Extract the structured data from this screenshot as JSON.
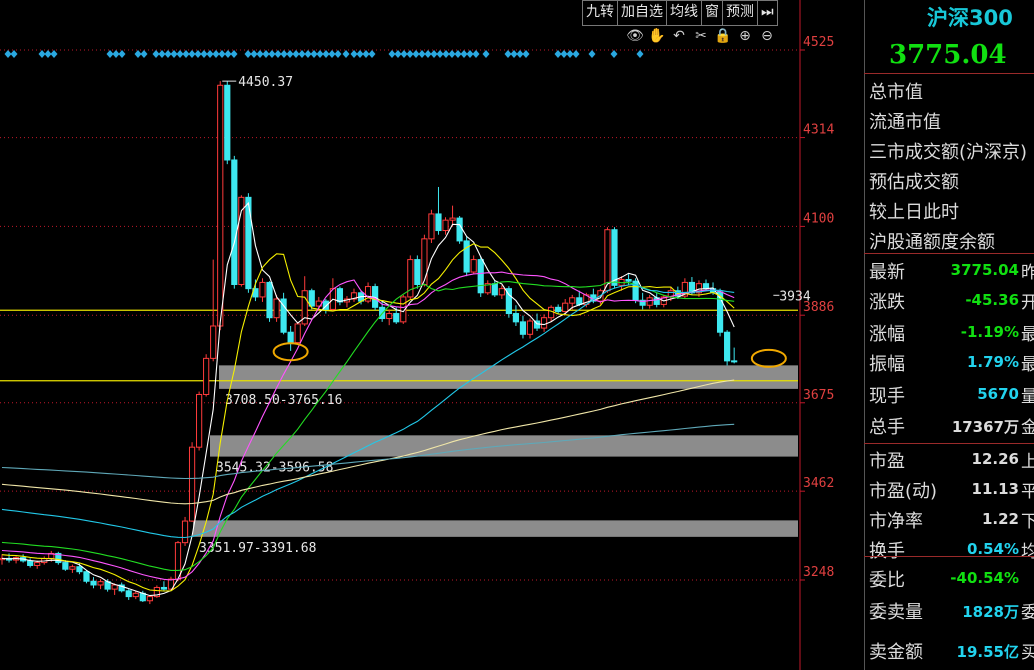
{
  "toolbar": {
    "items": [
      "九转",
      "加自选",
      "均线",
      "窗",
      "预测"
    ],
    "nav_icon": "play-to-end-icon"
  },
  "chart_icons": [
    "eye-icon",
    "hand-icon",
    "undo-icon",
    "scissors-icon",
    "lock-icon",
    "zoom-in-icon",
    "zoom-out-icon"
  ],
  "chart_data": {
    "type": "candlestick",
    "y_ticks": [
      "4525",
      "4314",
      "4100",
      "3886",
      "3675",
      "3462",
      "3248"
    ],
    "ylim": [
      3150,
      4560
    ],
    "annotations": {
      "high_label": "4450.37",
      "right_label": "3934"
    },
    "zones": [
      {
        "label": "3708.50-3765.16",
        "low": 3708.5,
        "high": 3765.16
      },
      {
        "label": "3545.32-3596.58",
        "low": 3545.32,
        "high": 3596.58
      },
      {
        "label": "3351.97-3391.68",
        "low": 3351.97,
        "high": 3391.68
      }
    ],
    "reference_lines": [
      3898,
      3728
    ],
    "candles": [
      {
        "o": 3297,
        "h": 3310,
        "l": 3285,
        "c": 3300
      },
      {
        "o": 3300,
        "h": 3312,
        "l": 3290,
        "c": 3296
      },
      {
        "o": 3296,
        "h": 3305,
        "l": 3288,
        "c": 3302
      },
      {
        "o": 3302,
        "h": 3310,
        "l": 3290,
        "c": 3294
      },
      {
        "o": 3294,
        "h": 3300,
        "l": 3278,
        "c": 3283
      },
      {
        "o": 3283,
        "h": 3295,
        "l": 3275,
        "c": 3290
      },
      {
        "o": 3290,
        "h": 3305,
        "l": 3285,
        "c": 3300
      },
      {
        "o": 3300,
        "h": 3318,
        "l": 3292,
        "c": 3312
      },
      {
        "o": 3312,
        "h": 3316,
        "l": 3285,
        "c": 3290
      },
      {
        "o": 3290,
        "h": 3296,
        "l": 3270,
        "c": 3274
      },
      {
        "o": 3274,
        "h": 3285,
        "l": 3265,
        "c": 3280
      },
      {
        "o": 3280,
        "h": 3290,
        "l": 3262,
        "c": 3268
      },
      {
        "o": 3268,
        "h": 3272,
        "l": 3240,
        "c": 3245
      },
      {
        "o": 3245,
        "h": 3255,
        "l": 3228,
        "c": 3236
      },
      {
        "o": 3236,
        "h": 3250,
        "l": 3226,
        "c": 3244
      },
      {
        "o": 3244,
        "h": 3250,
        "l": 3220,
        "c": 3226
      },
      {
        "o": 3226,
        "h": 3240,
        "l": 3212,
        "c": 3236
      },
      {
        "o": 3236,
        "h": 3242,
        "l": 3218,
        "c": 3222
      },
      {
        "o": 3222,
        "h": 3226,
        "l": 3200,
        "c": 3208
      },
      {
        "o": 3208,
        "h": 3222,
        "l": 3202,
        "c": 3216
      },
      {
        "o": 3216,
        "h": 3222,
        "l": 3195,
        "c": 3198
      },
      {
        "o": 3198,
        "h": 3212,
        "l": 3190,
        "c": 3208
      },
      {
        "o": 3208,
        "h": 3235,
        "l": 3205,
        "c": 3230
      },
      {
        "o": 3230,
        "h": 3245,
        "l": 3222,
        "c": 3226
      },
      {
        "o": 3226,
        "h": 3256,
        "l": 3224,
        "c": 3250
      },
      {
        "o": 3250,
        "h": 3342,
        "l": 3245,
        "c": 3338
      },
      {
        "o": 3338,
        "h": 3400,
        "l": 3330,
        "c": 3390
      },
      {
        "o": 3390,
        "h": 3580,
        "l": 3388,
        "c": 3568
      },
      {
        "o": 3568,
        "h": 3702,
        "l": 3560,
        "c": 3695
      },
      {
        "o": 3695,
        "h": 3792,
        "l": 3690,
        "c": 3782
      },
      {
        "o": 3782,
        "h": 4020,
        "l": 3775,
        "c": 3860
      },
      {
        "o": 3860,
        "h": 4450,
        "l": 3850,
        "c": 4440
      },
      {
        "o": 4440,
        "h": 4450,
        "l": 4250,
        "c": 4260
      },
      {
        "o": 4260,
        "h": 4270,
        "l": 3950,
        "c": 3960
      },
      {
        "o": 3960,
        "h": 4175,
        "l": 3955,
        "c": 4170
      },
      {
        "o": 4170,
        "h": 4180,
        "l": 3940,
        "c": 3950
      },
      {
        "o": 3950,
        "h": 3972,
        "l": 3920,
        "c": 3930
      },
      {
        "o": 3930,
        "h": 3975,
        "l": 3918,
        "c": 3965
      },
      {
        "o": 3965,
        "h": 3968,
        "l": 3870,
        "c": 3880
      },
      {
        "o": 3880,
        "h": 3935,
        "l": 3870,
        "c": 3925
      },
      {
        "o": 3925,
        "h": 3940,
        "l": 3840,
        "c": 3845
      },
      {
        "o": 3845,
        "h": 3860,
        "l": 3800,
        "c": 3820
      },
      {
        "o": 3820,
        "h": 3870,
        "l": 3815,
        "c": 3865
      },
      {
        "o": 3865,
        "h": 3980,
        "l": 3860,
        "c": 3945
      },
      {
        "o": 3945,
        "h": 3950,
        "l": 3900,
        "c": 3908
      },
      {
        "o": 3908,
        "h": 3930,
        "l": 3898,
        "c": 3920
      },
      {
        "o": 3920,
        "h": 3925,
        "l": 3890,
        "c": 3900
      },
      {
        "o": 3900,
        "h": 3975,
        "l": 3895,
        "c": 3950
      },
      {
        "o": 3950,
        "h": 3955,
        "l": 3910,
        "c": 3918
      },
      {
        "o": 3918,
        "h": 3932,
        "l": 3905,
        "c": 3925
      },
      {
        "o": 3925,
        "h": 3950,
        "l": 3918,
        "c": 3940
      },
      {
        "o": 3940,
        "h": 3946,
        "l": 3912,
        "c": 3920
      },
      {
        "o": 3920,
        "h": 3965,
        "l": 3915,
        "c": 3955
      },
      {
        "o": 3955,
        "h": 3962,
        "l": 3898,
        "c": 3905
      },
      {
        "o": 3905,
        "h": 3920,
        "l": 3870,
        "c": 3878
      },
      {
        "o": 3878,
        "h": 3900,
        "l": 3862,
        "c": 3890
      },
      {
        "o": 3890,
        "h": 3905,
        "l": 3865,
        "c": 3870
      },
      {
        "o": 3870,
        "h": 3935,
        "l": 3865,
        "c": 3930
      },
      {
        "o": 3930,
        "h": 4030,
        "l": 3925,
        "c": 4020
      },
      {
        "o": 4020,
        "h": 4030,
        "l": 3950,
        "c": 3960
      },
      {
        "o": 3960,
        "h": 4080,
        "l": 3955,
        "c": 4070
      },
      {
        "o": 4070,
        "h": 4140,
        "l": 4060,
        "c": 4130
      },
      {
        "o": 4130,
        "h": 4195,
        "l": 4080,
        "c": 4090
      },
      {
        "o": 4090,
        "h": 4122,
        "l": 4080,
        "c": 4115
      },
      {
        "o": 4115,
        "h": 4150,
        "l": 4100,
        "c": 4120
      },
      {
        "o": 4120,
        "h": 4125,
        "l": 4058,
        "c": 4065
      },
      {
        "o": 4065,
        "h": 4075,
        "l": 3980,
        "c": 3990
      },
      {
        "o": 3990,
        "h": 4030,
        "l": 3985,
        "c": 4020
      },
      {
        "o": 4020,
        "h": 4028,
        "l": 3930,
        "c": 3940
      },
      {
        "o": 3940,
        "h": 3970,
        "l": 3935,
        "c": 3962
      },
      {
        "o": 3962,
        "h": 3970,
        "l": 3930,
        "c": 3935
      },
      {
        "o": 3935,
        "h": 3958,
        "l": 3925,
        "c": 3950
      },
      {
        "o": 3950,
        "h": 3956,
        "l": 3880,
        "c": 3890
      },
      {
        "o": 3890,
        "h": 3910,
        "l": 3860,
        "c": 3870
      },
      {
        "o": 3870,
        "h": 3885,
        "l": 3830,
        "c": 3840
      },
      {
        "o": 3840,
        "h": 3878,
        "l": 3830,
        "c": 3872
      },
      {
        "o": 3872,
        "h": 3890,
        "l": 3848,
        "c": 3855
      },
      {
        "o": 3855,
        "h": 3888,
        "l": 3846,
        "c": 3880
      },
      {
        "o": 3880,
        "h": 3910,
        "l": 3870,
        "c": 3905
      },
      {
        "o": 3905,
        "h": 3912,
        "l": 3888,
        "c": 3895
      },
      {
        "o": 3895,
        "h": 3925,
        "l": 3890,
        "c": 3915
      },
      {
        "o": 3915,
        "h": 3935,
        "l": 3900,
        "c": 3928
      },
      {
        "o": 3928,
        "h": 3945,
        "l": 3908,
        "c": 3912
      },
      {
        "o": 3912,
        "h": 3940,
        "l": 3905,
        "c": 3935
      },
      {
        "o": 3935,
        "h": 3950,
        "l": 3915,
        "c": 3920
      },
      {
        "o": 3920,
        "h": 3950,
        "l": 3912,
        "c": 3945
      },
      {
        "o": 3945,
        "h": 4098,
        "l": 3940,
        "c": 4092
      },
      {
        "o": 4092,
        "h": 4098,
        "l": 3950,
        "c": 3958
      },
      {
        "o": 3958,
        "h": 3980,
        "l": 3945,
        "c": 3972
      },
      {
        "o": 3972,
        "h": 3985,
        "l": 3960,
        "c": 3968
      },
      {
        "o": 3968,
        "h": 3975,
        "l": 3915,
        "c": 3922
      },
      {
        "o": 3922,
        "h": 3940,
        "l": 3900,
        "c": 3910
      },
      {
        "o": 3910,
        "h": 3935,
        "l": 3902,
        "c": 3928
      },
      {
        "o": 3928,
        "h": 3940,
        "l": 3905,
        "c": 3912
      },
      {
        "o": 3912,
        "h": 3935,
        "l": 3905,
        "c": 3930
      },
      {
        "o": 3930,
        "h": 3955,
        "l": 3920,
        "c": 3945
      },
      {
        "o": 3945,
        "h": 3955,
        "l": 3925,
        "c": 3932
      },
      {
        "o": 3932,
        "h": 3975,
        "l": 3925,
        "c": 3965
      },
      {
        "o": 3965,
        "h": 3978,
        "l": 3935,
        "c": 3940
      },
      {
        "o": 3940,
        "h": 3970,
        "l": 3930,
        "c": 3962
      },
      {
        "o": 3962,
        "h": 3972,
        "l": 3945,
        "c": 3950
      },
      {
        "o": 3950,
        "h": 3965,
        "l": 3935,
        "c": 3942
      },
      {
        "o": 3942,
        "h": 3950,
        "l": 3835,
        "c": 3845
      },
      {
        "o": 3845,
        "h": 3850,
        "l": 3765,
        "c": 3776
      },
      {
        "o": 3776,
        "h": 3808,
        "l": 3770,
        "c": 3775
      }
    ]
  },
  "panel": {
    "title": "沪深300",
    "price": "3775.04",
    "rows": [
      {
        "label": "总市值",
        "value": "",
        "ext": "",
        "color": "#dcdcdc"
      },
      {
        "label": "流通市值",
        "value": "",
        "ext": "",
        "color": "#dcdcdc"
      },
      {
        "label": "三市成交额(沪深京)",
        "value": "",
        "ext": "",
        "color": "#dcdcdc"
      },
      {
        "label": "预估成交额",
        "value": "",
        "ext": "",
        "color": "#dcdcdc"
      },
      {
        "label": "较上日此时",
        "value": "",
        "ext": "",
        "color": "#dcdcdc"
      },
      {
        "label": "沪股通额度余额",
        "value": "",
        "ext": "",
        "color": "#dcdcdc"
      },
      {
        "label": "最新",
        "value": "3775.04",
        "ext": "昨",
        "color": "#11e011"
      },
      {
        "label": "涨跌",
        "value": "-45.36",
        "ext": "开",
        "color": "#11e011"
      },
      {
        "label": "涨幅",
        "value": "-1.19%",
        "ext": "最",
        "color": "#11e011"
      },
      {
        "label": "振幅",
        "value": "1.79%",
        "ext": "最",
        "color": "#22d3ee"
      },
      {
        "label": "现手",
        "value": "5670",
        "ext": "量",
        "color": "#22d3ee"
      },
      {
        "label": "总手",
        "value": "17367万",
        "ext": "金",
        "color": "#dcdcdc"
      },
      {
        "label": "市盈",
        "value": "12.26",
        "ext": "上",
        "color": "#dcdcdc"
      },
      {
        "label": "市盈(动)",
        "value": "11.13",
        "ext": "平",
        "color": "#dcdcdc"
      },
      {
        "label": "市净率",
        "value": "1.22",
        "ext": "下",
        "color": "#dcdcdc"
      },
      {
        "label": "换手",
        "value": "0.54%",
        "ext": "均",
        "color": "#22d3ee"
      },
      {
        "label": "委比",
        "value": "-40.54%",
        "ext": "",
        "color": "#11e011"
      },
      {
        "label": "委卖量",
        "value": "1828万",
        "ext": "委",
        "color": "#22d3ee"
      },
      {
        "label": "卖金额",
        "value": "19.55亿",
        "ext": "买",
        "color": "#22d3ee"
      }
    ]
  },
  "colors": {
    "up": "#ff3b3b",
    "down": "#3ee8f0",
    "axis": "#c0182a",
    "yellow_line": "#e8e000",
    "ma5": "#ffffff",
    "ma10": "#f5f000",
    "ma20": "#ff55ff",
    "ma30": "#22dd22",
    "ma60": "#22c8e8",
    "ma120": "#f0e6a8",
    "ma250": "#5fa8b8",
    "zone": "#8c8c8c",
    "circle": "#f0a800"
  }
}
